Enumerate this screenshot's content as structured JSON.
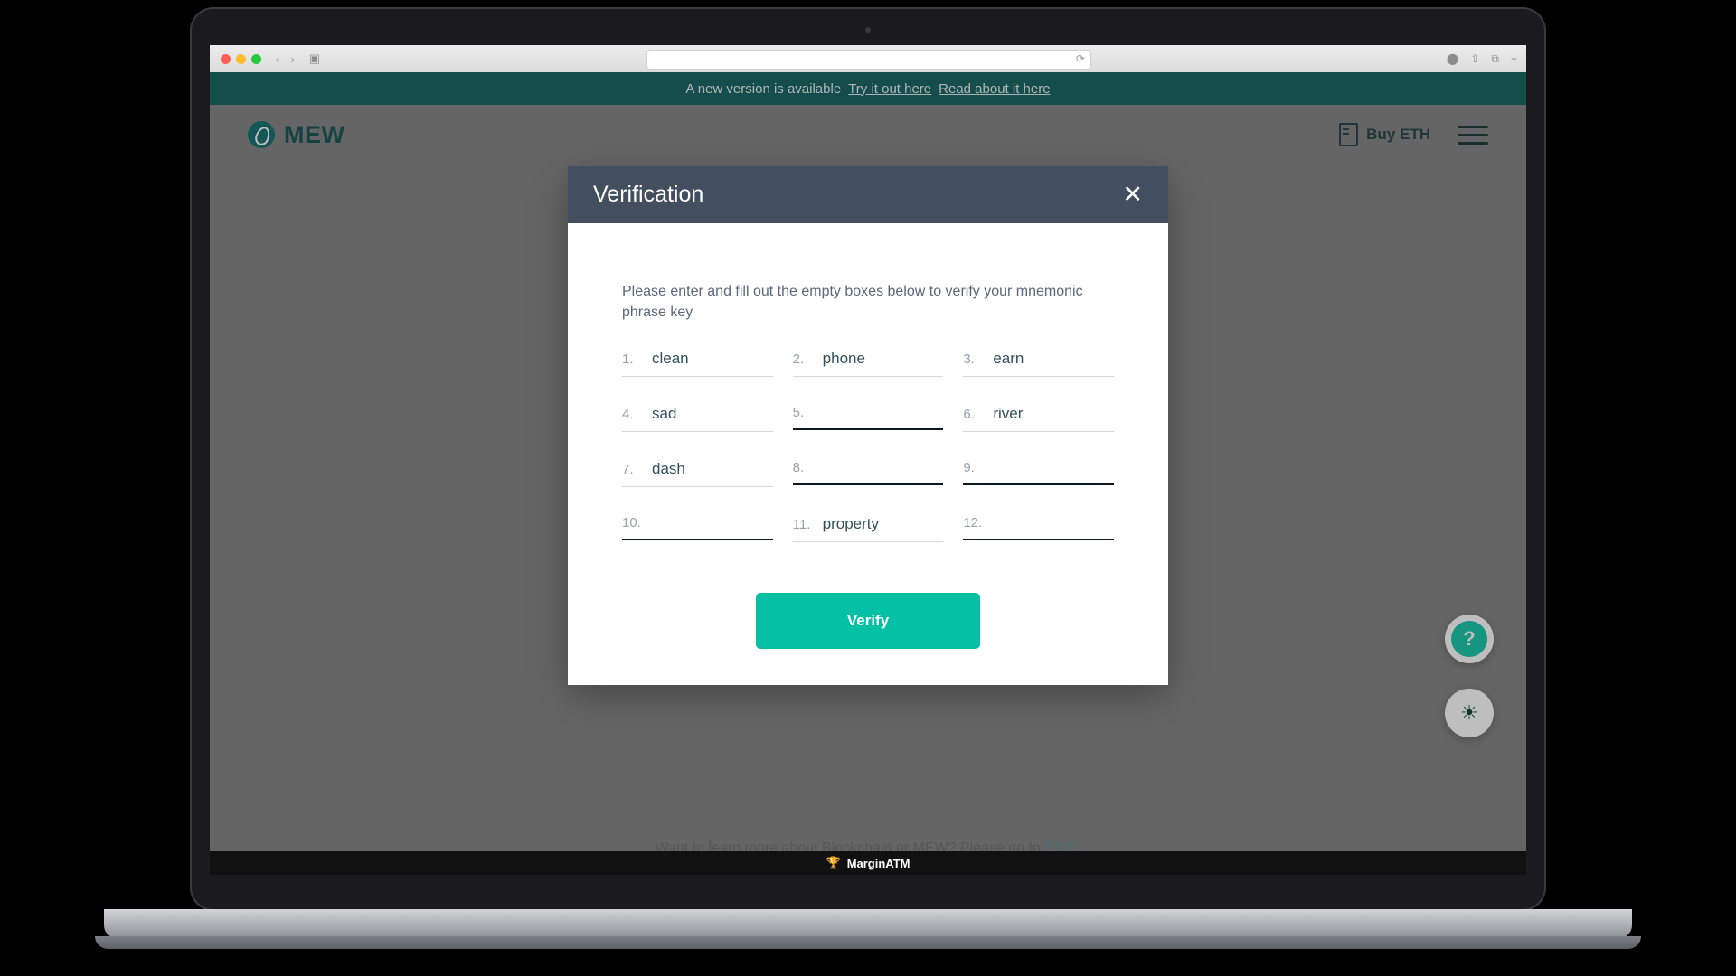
{
  "browser": {
    "back_label": "‹",
    "forward_label": "›",
    "sidebar_icon": "sidebar-icon",
    "reload_icon": "reload-icon",
    "url_value": "",
    "url_placeholder": "",
    "share_icon": "share-icon",
    "tabs_icon": "tabs-icon",
    "newtab_label": "+"
  },
  "banner": {
    "message": "A new version is available",
    "link_try": "Try it out here",
    "link_read": "Read about it here"
  },
  "header": {
    "brand": "MEW",
    "buy_eth": "Buy ETH",
    "menu_icon": "hamburger-menu-icon",
    "wallet_icon": "card-icon"
  },
  "modal": {
    "title": "Verification",
    "close_icon": "close-icon",
    "instruction": "Please enter and fill out the empty boxes below to verify your mnemonic phrase key",
    "verify_label": "Verify",
    "words": [
      {
        "num": "1.",
        "value": "clean",
        "filled": true
      },
      {
        "num": "2.",
        "value": "phone",
        "filled": true
      },
      {
        "num": "3.",
        "value": "earn",
        "filled": true
      },
      {
        "num": "4.",
        "value": "sad",
        "filled": true
      },
      {
        "num": "5.",
        "value": "",
        "filled": false
      },
      {
        "num": "6.",
        "value": "river",
        "filled": true
      },
      {
        "num": "7.",
        "value": "dash",
        "filled": true
      },
      {
        "num": "8.",
        "value": "",
        "filled": false
      },
      {
        "num": "9.",
        "value": "",
        "filled": false
      },
      {
        "num": "10.",
        "value": "",
        "filled": false
      },
      {
        "num": "11.",
        "value": "property",
        "filled": true
      },
      {
        "num": "12.",
        "value": "",
        "filled": false
      }
    ]
  },
  "floating": {
    "help_label": "?",
    "lamp_icon": "lamp-icon"
  },
  "footer": {
    "text": "Want to learn more about Blockchain or MEW? Please go to ",
    "link": "FAQs"
  },
  "taskbar": {
    "app_name": "MarginATM",
    "app_icon": "margin-atm-icon"
  },
  "colors": {
    "banner_bg": "#0d5c5c",
    "modal_header": "#434e5f",
    "accent_teal": "#05c0a5",
    "brand_teal": "#0e4f4f"
  }
}
